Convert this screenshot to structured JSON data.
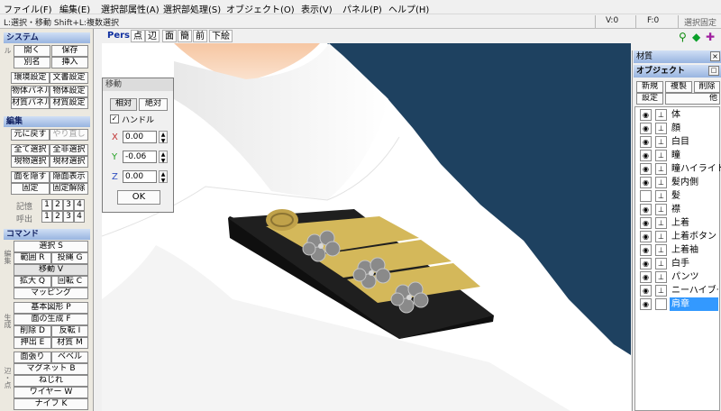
{
  "menu": [
    "ファイル(F)",
    "編集(E)",
    "選択部属性(A)",
    "選択部処理(S)",
    "オブジェクト(O)",
    "表示(V)",
    "パネル(P)",
    "ヘルプ(H)"
  ],
  "status": {
    "hint": "L:選択・移動 Shift+L:複数選択",
    "v": "V:0",
    "f": "F:0",
    "lock": "選択固定"
  },
  "view_toolbar": [
    "Pers",
    "点",
    "辺",
    "面",
    "簡",
    "前",
    "下絵"
  ],
  "left": {
    "system": {
      "title": "システム",
      "side": "ファイル",
      "open": "開く",
      "save": "保存",
      "saveas": "別名",
      "insert": "挿入",
      "env": "環境設定",
      "doc": "文書設定",
      "objpanel": "物体パネル",
      "objset": "物体設定",
      "matpanel": "材質パネル",
      "matset": "材質設定"
    },
    "edit": {
      "title": "編集",
      "undo": "元に戻す",
      "redo": "やり直し",
      "selall": "全て選択",
      "deselall": "全非選択",
      "curobj": "現物選択",
      "curmat": "現材選択",
      "hideface": "面を隠す",
      "showface": "隠面表示",
      "fix": "固定",
      "unfix": "固定解除",
      "mem": "記憶",
      "recall": "呼出",
      "n1": "1",
      "n2": "2",
      "n3": "3",
      "n4": "4"
    },
    "command": {
      "title": "コマンド",
      "g1": "編集",
      "sel": "選択 S",
      "range": "範囲 R",
      "lasso": "投縄 G",
      "move": "移動 V",
      "scale": "拡大 Q",
      "rotate": "回転 C",
      "mapping": "マッピング",
      "g2": "生成",
      "prim": "基本図形 P",
      "face": "面の生成 F",
      "del": "削除 D",
      "flip": "反転 I",
      "extrude": "押出 E",
      "mat": "材質 M",
      "g3": "辺・点",
      "stretch": "面張り",
      "bevel": "ベベル",
      "magnet": "マグネット B",
      "twist": "ねじれ",
      "wire": "ワイヤー W",
      "knife": "ナイフ K"
    }
  },
  "move_dialog": {
    "title": "移動",
    "rel": "相対",
    "abs": "絶対",
    "handle": "ハンドル",
    "x_label": "X",
    "y_label": "Y",
    "z_label": "Z",
    "x": "0.00",
    "y": "-0.06",
    "z": "0.00",
    "ok": "OK"
  },
  "material_panel": {
    "title": "材質"
  },
  "object_panel": {
    "title": "オブジェクト",
    "new": "新規",
    "dup": "複製",
    "del": "削除",
    "set": "設定",
    "other": "他",
    "objects": [
      {
        "name": "体"
      },
      {
        "name": "顔"
      },
      {
        "name": "白目"
      },
      {
        "name": "瞳"
      },
      {
        "name": "瞳ハイライト"
      },
      {
        "name": "髪内側"
      },
      {
        "name": "髪"
      },
      {
        "name": "襟"
      },
      {
        "name": "上着"
      },
      {
        "name": "上着ボタン"
      },
      {
        "name": "上着袖"
      },
      {
        "name": "白手"
      },
      {
        "name": "パンツ"
      },
      {
        "name": "ニーハイブーツ"
      },
      {
        "name": "肩章"
      }
    ]
  },
  "colors": {
    "section": "#98b4e0",
    "dark_body": "#1e4160",
    "selected": "#3399ff",
    "gold": "#d4b85a"
  }
}
